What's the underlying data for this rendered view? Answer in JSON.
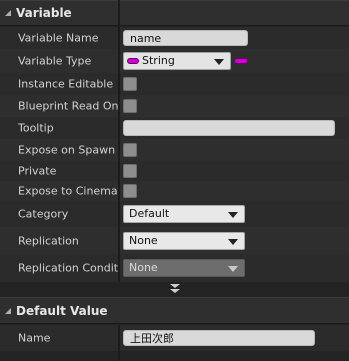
{
  "sections": {
    "variable": {
      "title": "Variable"
    },
    "default_value": {
      "title": "Default Value"
    }
  },
  "rows": {
    "variable_name": {
      "label": "Variable Name",
      "value": "name"
    },
    "variable_type": {
      "label": "Variable Type",
      "value": "String",
      "pin_color": "#d200d2"
    },
    "instance_editable": {
      "label": "Instance Editable",
      "checked": false
    },
    "blueprint_read_only": {
      "label": "Blueprint Read Only",
      "checked": false
    },
    "tooltip": {
      "label": "Tooltip",
      "value": ""
    },
    "expose_on_spawn": {
      "label": "Expose on Spawn",
      "checked": false
    },
    "private": {
      "label": "Private",
      "checked": false
    },
    "expose_to_cinematics": {
      "label": "Expose to Cinematics",
      "checked": false
    },
    "category": {
      "label": "Category",
      "value": "Default"
    },
    "replication": {
      "label": "Replication",
      "value": "None"
    },
    "replication_condition": {
      "label": "Replication Condition",
      "value": "None",
      "enabled": false
    },
    "default_name": {
      "label": "Name",
      "value": "上田次郎"
    }
  },
  "icons": {
    "collapse_arrow": "triangle-down-icon",
    "advanced_expander": "double-chevron-down-icon",
    "type_pin": "pill-pin-icon"
  }
}
